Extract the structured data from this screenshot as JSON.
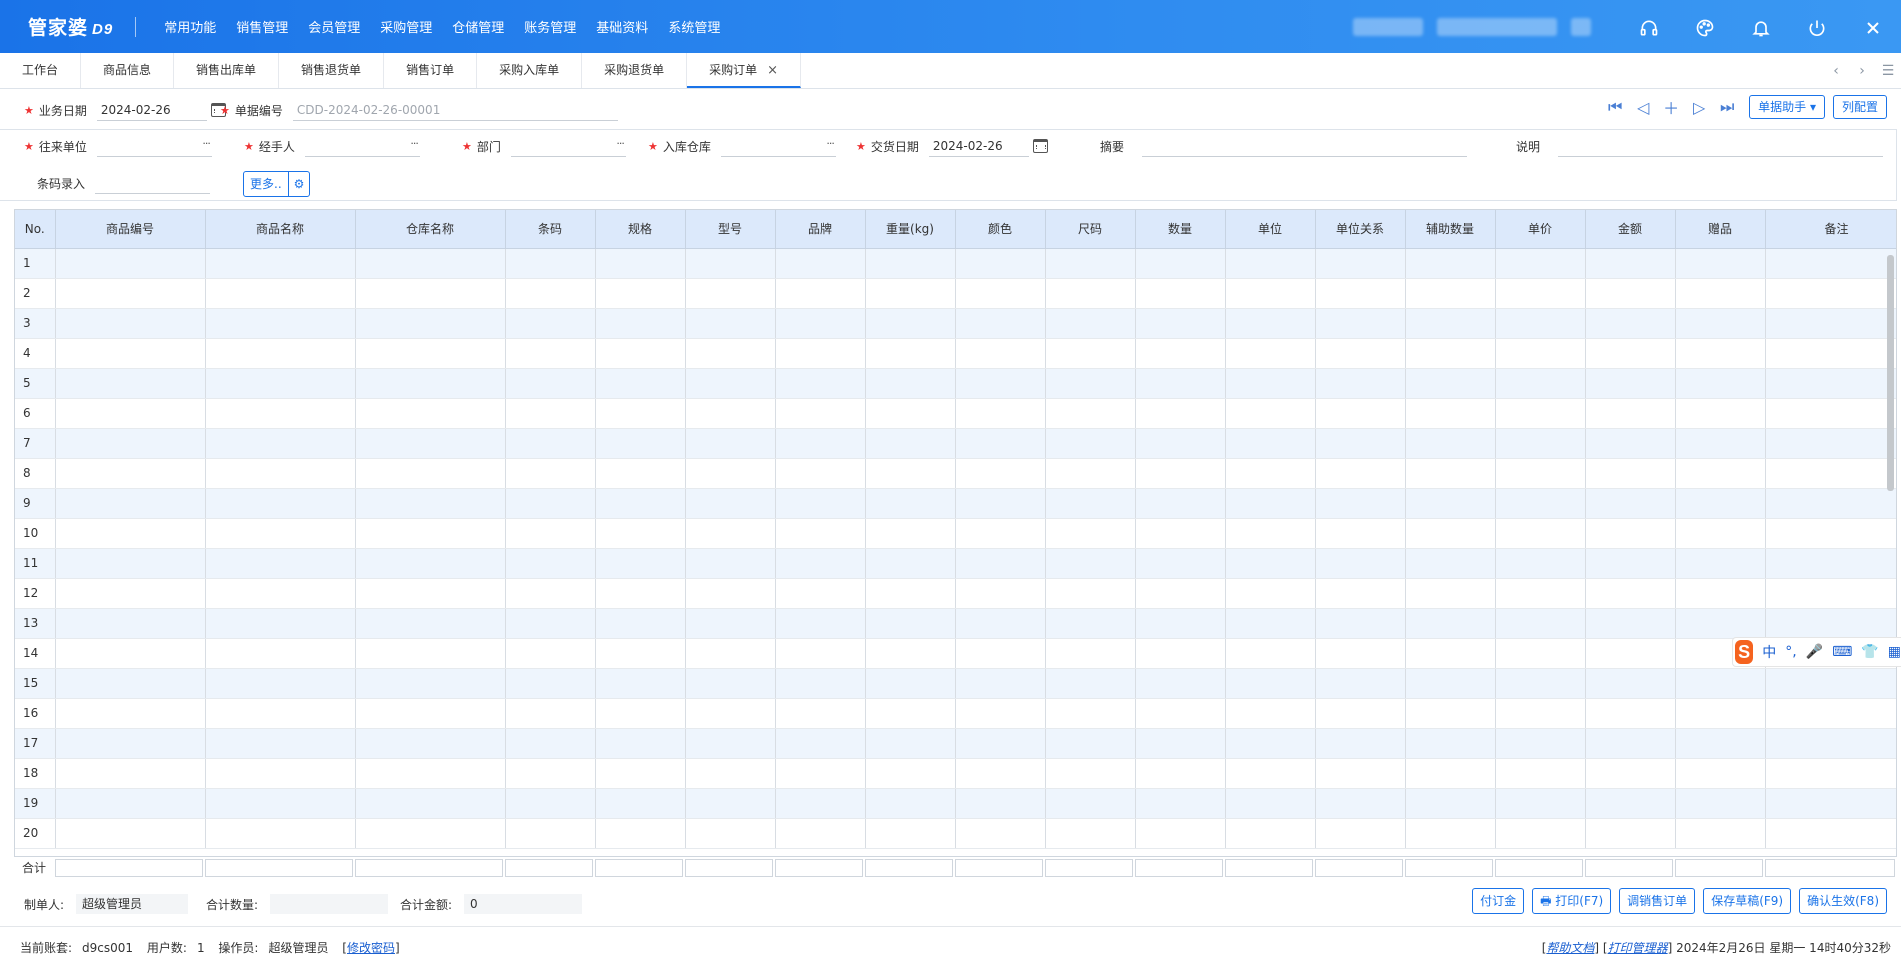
{
  "header": {
    "logo": "管家婆",
    "logo_sub": "D9",
    "nav": [
      "常用功能",
      "销售管理",
      "会员管理",
      "采购管理",
      "仓储管理",
      "账务管理",
      "基础资料",
      "系统管理"
    ],
    "icons": [
      "headset-icon",
      "palette-icon",
      "bell-icon",
      "power-icon",
      "close-icon"
    ]
  },
  "tabs": {
    "items": [
      "工作台",
      "商品信息",
      "销售出库单",
      "销售退货单",
      "销售订单",
      "采购入库单",
      "采购退货单",
      "采购订单"
    ],
    "active_close": "×"
  },
  "form": {
    "biz_date_label": "业务日期",
    "biz_date_value": "2024-02-26",
    "doc_no_label": "单据编号",
    "doc_no_value": "CDD-2024-02-26-00001",
    "partner_label": "往来单位",
    "handler_label": "经手人",
    "dept_label": "部门",
    "warehouse_label": "入库仓库",
    "delivery_date_label": "交货日期",
    "delivery_date_value": "2024-02-26",
    "summary_label": "摘要",
    "note_label": "说明",
    "barcode_label": "条码录入",
    "more_label": "更多..",
    "dots": "···",
    "helper_label": "单据助手 ▾",
    "columns_config_label": "列配置"
  },
  "grid": {
    "columns": [
      "No.",
      "商品编号",
      "商品名称",
      "仓库名称",
      "条码",
      "规格",
      "型号",
      "品牌",
      "重量(kg)",
      "颜色",
      "尺码",
      "数量",
      "单位",
      "单位关系",
      "辅助数量",
      "单价",
      "金额",
      "赠品",
      "备注"
    ],
    "rows": [
      "1",
      "2",
      "3",
      "4",
      "5",
      "6",
      "7",
      "8",
      "9",
      "10",
      "11",
      "12",
      "13",
      "14",
      "15",
      "16",
      "17",
      "18",
      "19",
      "20"
    ],
    "total_label": "合计"
  },
  "footer": {
    "maker_label": "制单人:",
    "maker_value": "超级管理员",
    "qty_label": "合计数量:",
    "qty_value": "",
    "amount_label": "合计金额:",
    "amount_value": "0",
    "buttons": [
      "付订金",
      "打印(F7)",
      "调销售订单",
      "保存草稿(F9)",
      "确认生效(F8)"
    ]
  },
  "status": {
    "account_label": "当前账套:",
    "account_value": "d9cs001",
    "users_label": "用户数:",
    "users_value": "1",
    "operator_label": "操作员:",
    "operator_value": "超级管理员",
    "change_pwd": "修改密码",
    "help_doc": "帮助文档",
    "print_mgr": "打印管理器",
    "datetime": "2024年2月26日 星期一 14时40分32秒"
  },
  "ime": {
    "logo": "S",
    "items": [
      "中",
      "°,",
      "🎤",
      "⌨",
      "👕",
      "▦"
    ]
  }
}
